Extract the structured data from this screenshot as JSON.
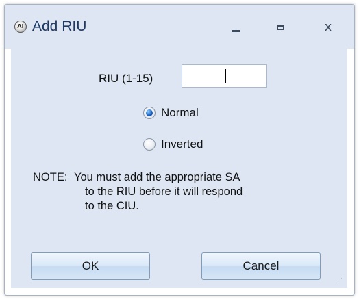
{
  "window": {
    "title": "Add RIU",
    "app_icon_text": "AI",
    "controls": {
      "minimize": "minimize",
      "maximize": "maximize",
      "close": "x"
    }
  },
  "form": {
    "riu_label": "RIU (1-15)",
    "riu_value": "",
    "riu_placeholder": "",
    "options": [
      {
        "label": "Normal",
        "checked": true
      },
      {
        "label": "Inverted",
        "checked": false
      }
    ],
    "note": {
      "prefix": "NOTE:",
      "line1": "You must add the appropriate SA",
      "line2": "to the RIU before it will respond",
      "line3": "to the CIU."
    }
  },
  "buttons": {
    "ok": "OK",
    "cancel": "Cancel"
  },
  "colors": {
    "chrome": "#dde6f2",
    "title_text": "#1e3a66",
    "radio_selected": "#1c63c7"
  },
  "icons": {
    "app": "app-logo-icon",
    "minimize": "minimize-icon",
    "maximize": "maximize-icon",
    "close": "close-icon",
    "resize": "resize-grip-icon"
  }
}
